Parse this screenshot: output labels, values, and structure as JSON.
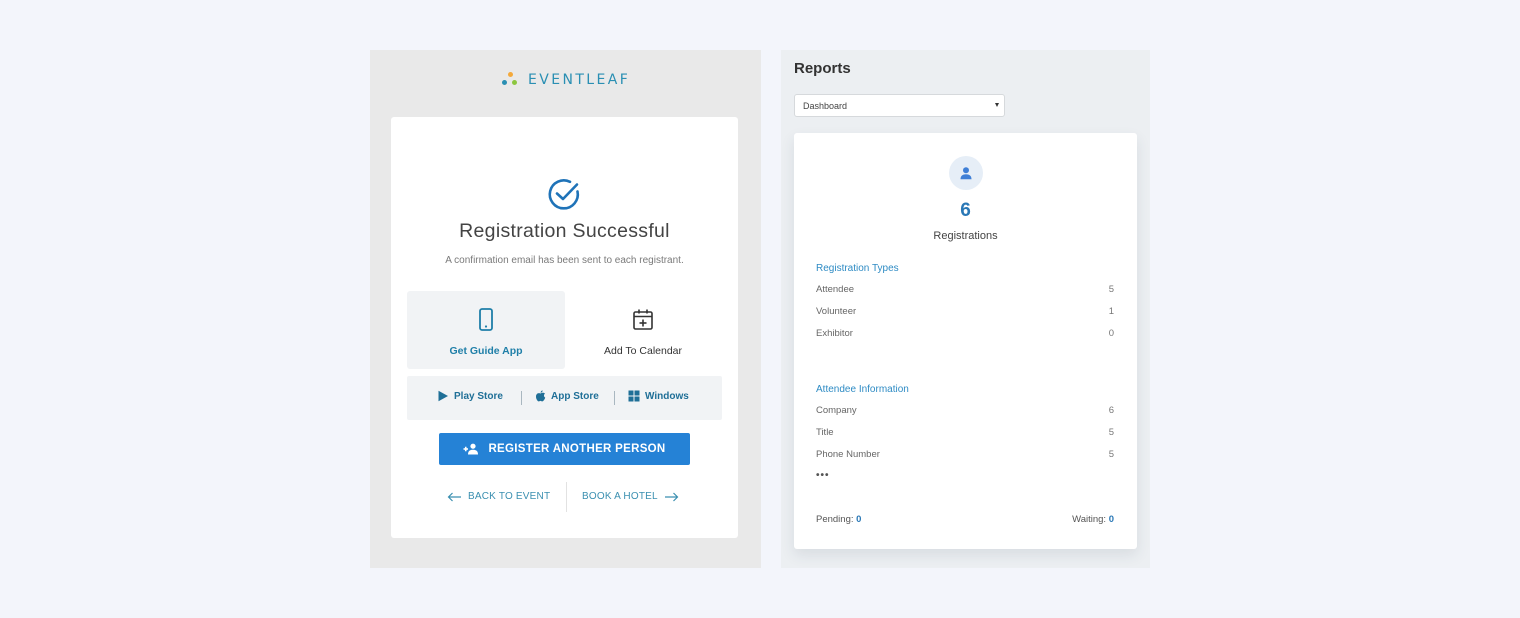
{
  "logo": {
    "text": "EVENTLEAF",
    "dot_colors": [
      "#f4a93a",
      "#2a8fb3",
      "#8cc63f"
    ]
  },
  "registration": {
    "title": "Registration Successful",
    "subtitle": "A confirmation email has been sent to each registrant.",
    "options": [
      {
        "label": "Get Guide App",
        "icon": "smartphone-icon"
      },
      {
        "label": "Add To Calendar",
        "icon": "calendar-add-icon"
      }
    ],
    "stores": [
      {
        "label": "Play Store",
        "icon": "play-store-icon"
      },
      {
        "label": "App Store",
        "icon": "apple-icon"
      },
      {
        "label": "Windows",
        "icon": "windows-icon"
      }
    ],
    "register_button": "REGISTER ANOTHER PERSON",
    "back_link": "BACK TO EVENT",
    "hotel_link": "BOOK A HOTEL"
  },
  "reports": {
    "title": "Reports",
    "select_value": "Dashboard",
    "count": "6",
    "count_label": "Registrations",
    "types_heading": "Registration Types",
    "types": [
      {
        "label": "Attendee",
        "value": "5"
      },
      {
        "label": "Volunteer",
        "value": "1"
      },
      {
        "label": "Exhibitor",
        "value": "0"
      }
    ],
    "info_heading": "Attendee Information",
    "info": [
      {
        "label": "Company",
        "value": "6"
      },
      {
        "label": "Title",
        "value": "5"
      },
      {
        "label": "Phone Number",
        "value": "5"
      }
    ],
    "ellipsis": "•••",
    "pending_label": "Pending:",
    "pending_value": "0",
    "waiting_label": "Waiting:",
    "waiting_value": "0"
  },
  "colors": {
    "accent": "#2582d6",
    "link": "#2a8fb3",
    "page_bg": "#f3f5fb"
  }
}
